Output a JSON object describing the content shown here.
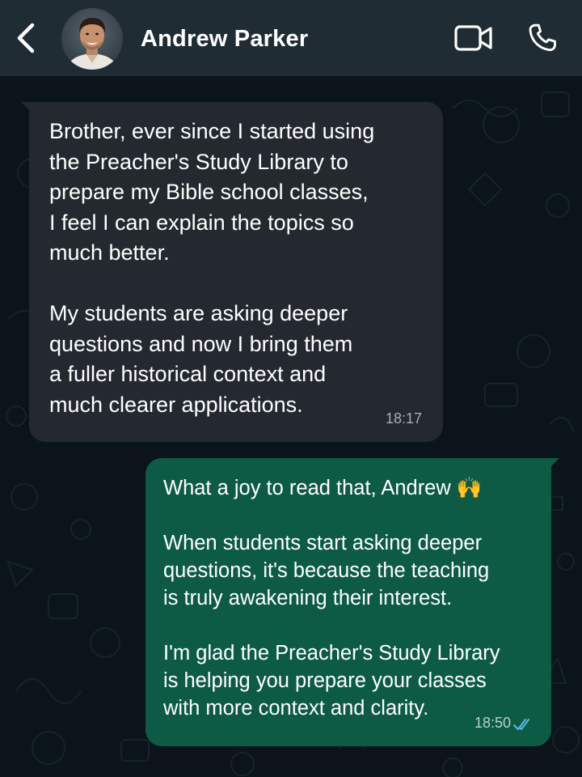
{
  "header": {
    "contact_name": "Andrew Parker",
    "back_icon": "chevron-left-icon",
    "video_icon": "video-camera-icon",
    "call_icon": "phone-icon"
  },
  "messages": [
    {
      "direction": "incoming",
      "text": "Brother, ever since I started using\nthe Preacher's Study Library to\nprepare my Bible school classes,\nI feel I can explain the topics so\nmuch better.\n\nMy students are asking deeper\nquestions and now I bring them\na fuller historical context and\nmuch clearer applications.",
      "time": "18:17"
    },
    {
      "direction": "outgoing",
      "text": "What a joy to read that, Andrew 🙌\n\nWhen students start asking deeper\nquestions, it's because the teaching\nis truly awakening their interest.\n\nI'm glad the Preacher's Study Library\nis helping you prepare your classes\nwith more context and clarity.",
      "time": "18:50",
      "status": "read"
    }
  ],
  "colors": {
    "header_bg": "#1f2c34",
    "chat_bg": "#0b141a",
    "incoming_bubble": "#23292e",
    "outgoing_bubble": "#0d5b44",
    "read_ticks": "#53bdeb"
  }
}
